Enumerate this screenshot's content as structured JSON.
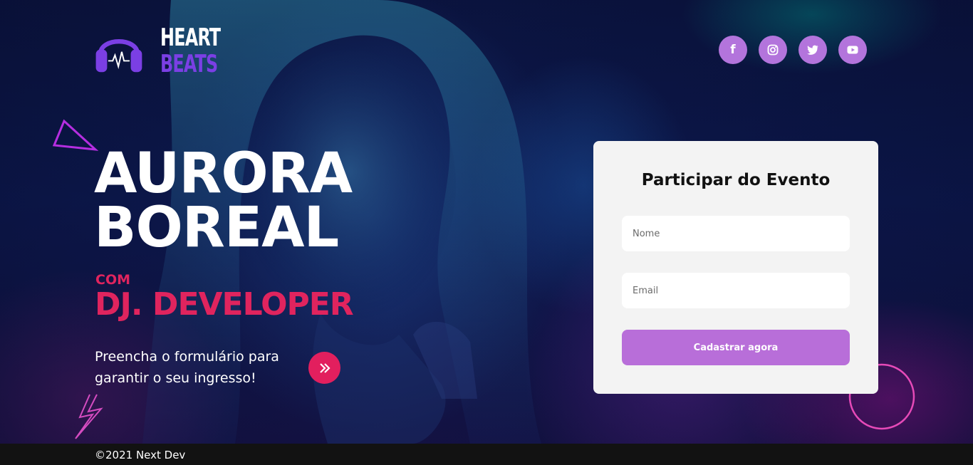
{
  "brand": {
    "line1": "HEART",
    "line2": "BEATS",
    "logo_icon": "headphones-heartbeat-icon",
    "colors": {
      "accent": "#7b3fe4",
      "pink": "#e0245e",
      "button": "#b86ed9",
      "social": "#b374dc"
    }
  },
  "socials": [
    {
      "name": "facebook-icon",
      "label": "f"
    },
    {
      "name": "instagram-icon"
    },
    {
      "name": "twitter-icon"
    },
    {
      "name": "youtube-icon"
    }
  ],
  "hero": {
    "title_line1": "AURORA",
    "title_line2": "BOREAL",
    "with_label": "COM",
    "artist": "DJ. DEVELOPER",
    "cta_line1": "Preencha o formulário para",
    "cta_line2": "garantir o seu ingresso!",
    "cta_icon": "double-chevron-right-icon"
  },
  "form": {
    "title": "Participar do Evento",
    "name_placeholder": "Nome",
    "email_placeholder": "Email",
    "submit_label": "Cadastrar agora"
  },
  "footer": {
    "copyright": "©2021 Next Dev"
  }
}
